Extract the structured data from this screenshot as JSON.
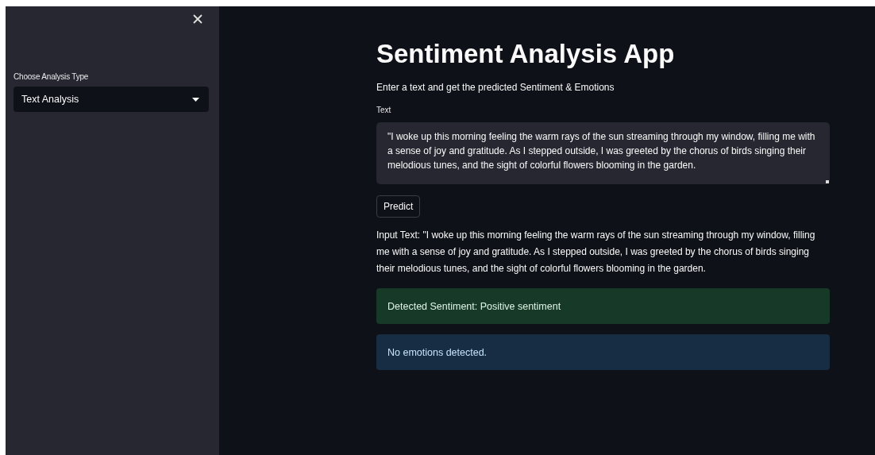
{
  "sidebar": {
    "select": {
      "label": "Choose Analysis Type",
      "value": "Text Analysis"
    }
  },
  "main": {
    "title": "Sentiment Analysis App",
    "subtitle": "Enter a text and get the predicted Sentiment & Emotions",
    "text_area": {
      "label": "Text",
      "value": "\"I woke up this morning feeling the warm rays of the sun streaming through my window, filling me with a sense of joy and gratitude. As I stepped outside, I was greeted by the chorus of birds singing their melodious tunes, and the sight of colorful flowers blooming in the garden."
    },
    "button": "Predict",
    "output": "Input Text: \"I woke up this morning feeling the warm rays of the sun streaming through my window, filling me with a sense of joy and gratitude. As I stepped outside, I was greeted by the chorus of birds singing their melodious tunes, and the sight of colorful flowers blooming in the garden.",
    "alerts": [
      {
        "kind": "success",
        "text": "Detected Sentiment: Positive sentiment"
      },
      {
        "kind": "info",
        "text": "No emotions detected."
      }
    ]
  }
}
